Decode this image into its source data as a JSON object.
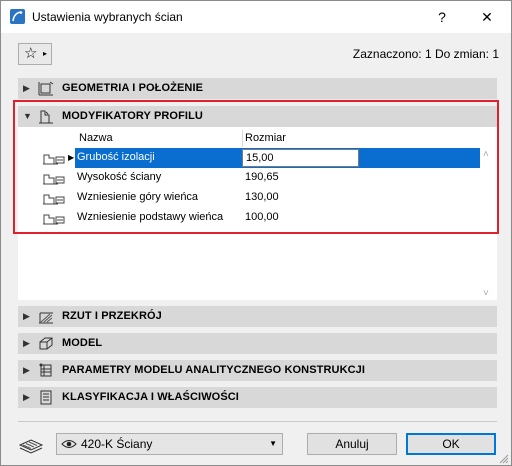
{
  "window": {
    "title": "Ustawienia wybranych ścian",
    "help_label": "?",
    "close_label": "✕"
  },
  "toolbar": {
    "favorites_icon": "star-icon",
    "favorites_arrow": "▸",
    "selection_info": "Zaznaczono: 1 Do zmian: 1"
  },
  "panels": [
    {
      "label": "GEOMETRIA I POŁOŻENIE",
      "icon": "geometry-icon",
      "state": "collapsed"
    },
    {
      "label": "MODYFIKATORY PROFILU",
      "icon": "profile-modifier-icon",
      "state": "expanded"
    },
    {
      "label": "RZUT I PRZEKRÓJ",
      "icon": "floor-plan-icon",
      "state": "collapsed"
    },
    {
      "label": "MODEL",
      "icon": "model-icon",
      "state": "collapsed"
    },
    {
      "label": "PARAMETRY MODELU ANALITYCZNEGO KONSTRUKCJI",
      "icon": "structural-icon",
      "state": "collapsed"
    },
    {
      "label": "KLASYFIKACJA I WŁAŚCIWOŚCI",
      "icon": "classification-icon",
      "state": "collapsed"
    }
  ],
  "chevrons": {
    "collapsed": "▶",
    "expanded": "▼",
    "row_marker": "▶"
  },
  "table": {
    "headers": [
      "Nazwa",
      "Rozmiar"
    ],
    "rows": [
      {
        "name": "Grubość izolacji",
        "value": "15,00",
        "selected": true
      },
      {
        "name": "Wysokość ściany",
        "value": "190,65",
        "selected": false
      },
      {
        "name": "Wzniesienie góry wieńca",
        "value": "130,00",
        "selected": false
      },
      {
        "name": "Wzniesienie podstawy wieńca",
        "value": "100,00",
        "selected": false
      }
    ]
  },
  "scrollbar": {
    "up": "˄",
    "down": "˅"
  },
  "footer": {
    "view_value": "420-K Ściany",
    "view_arrow": "▼",
    "cancel_label": "Anuluj",
    "ok_label": "OK"
  },
  "colors": {
    "selection": "#0a6ed1",
    "highlight_border": "#e0202a",
    "panel_bg": "#d8d8d8"
  }
}
